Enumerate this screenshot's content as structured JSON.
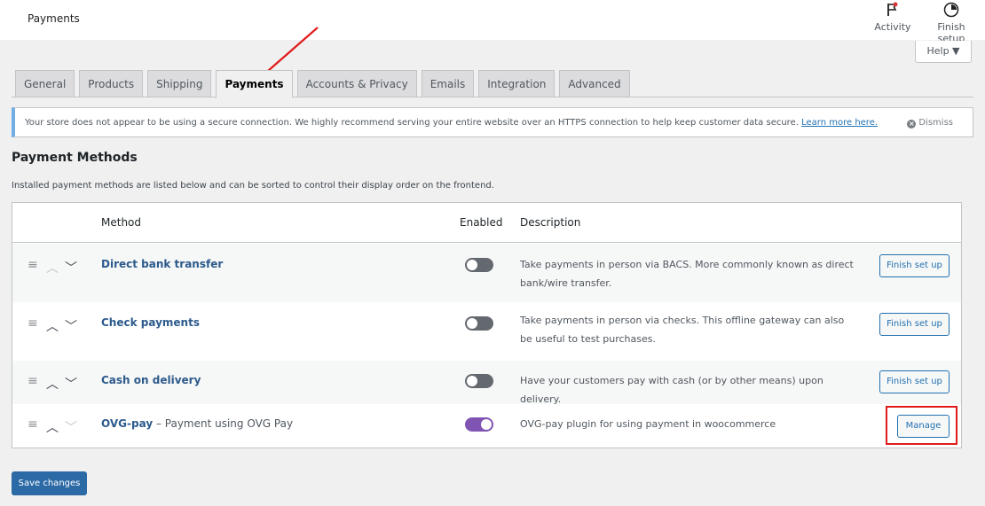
{
  "header": {
    "title": "Payments",
    "activity_label": "Activity",
    "finish_setup_label": "Finish setup"
  },
  "help": {
    "label": "Help ▼"
  },
  "tabs": [
    {
      "label": "General"
    },
    {
      "label": "Products"
    },
    {
      "label": "Shipping"
    },
    {
      "label": "Payments"
    },
    {
      "label": "Accounts & Privacy"
    },
    {
      "label": "Emails"
    },
    {
      "label": "Integration"
    },
    {
      "label": "Advanced"
    }
  ],
  "notice": {
    "text": "Your store does not appear to be using a secure connection. We highly recommend serving your entire website over an HTTPS connection to help keep customer data secure.",
    "link": "Learn more here.",
    "dismiss": "Dismiss"
  },
  "section": {
    "title": "Payment Methods",
    "intro": "Installed payment methods are listed below and can be sorted to control their display order on the frontend."
  },
  "table": {
    "columns": {
      "method": "Method",
      "enabled": "Enabled",
      "description": "Description"
    },
    "rows": [
      {
        "name": "Direct bank transfer",
        "sub": "",
        "enabled": false,
        "description": "Take payments in person via BACS. More commonly known as direct bank/wire transfer.",
        "action": "Finish set up"
      },
      {
        "name": "Check payments",
        "sub": "",
        "enabled": false,
        "description": "Take payments in person via checks. This offline gateway can also be useful to test purchases.",
        "action": "Finish set up"
      },
      {
        "name": "Cash on delivery",
        "sub": "",
        "enabled": false,
        "description": "Have your customers pay with cash (or by other means) upon delivery.",
        "action": "Finish set up"
      },
      {
        "name": "OVG-pay",
        "sub": " – Payment using OVG Pay",
        "enabled": true,
        "description": "OVG-pay plugin for using payment in woocommerce",
        "action": "Manage"
      }
    ]
  },
  "save_label": "Save changes",
  "colors": {
    "accent": "#2271b1",
    "toggle_on": "#7f54b3",
    "highlight": "#e01b1b",
    "notice_border": "#72aee6"
  }
}
